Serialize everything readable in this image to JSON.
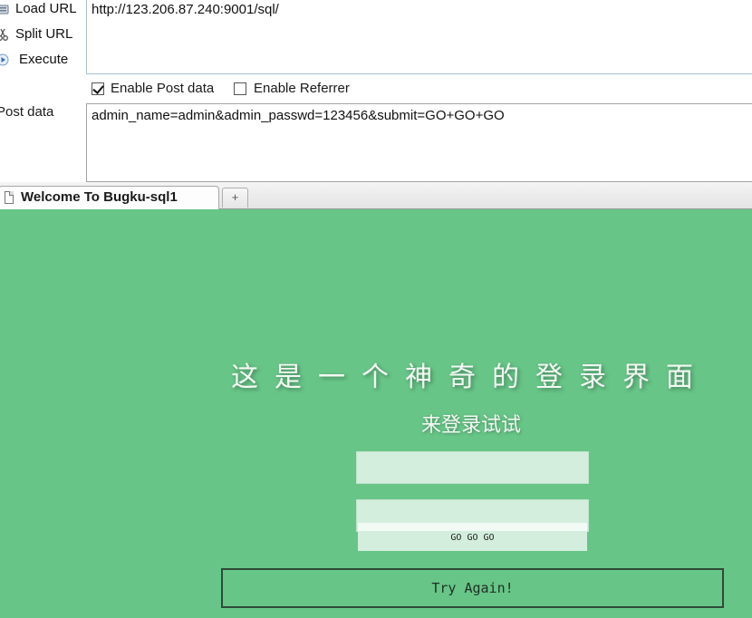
{
  "hackbar": {
    "buttons": {
      "load_url": "Load URL",
      "split_url": "Split URL",
      "execute": "Execute"
    },
    "url_value": "http://123.206.87.240:9001/sql/",
    "options": {
      "enable_post_data": "Enable Post data",
      "enable_post_data_checked": true,
      "enable_referrer": "Enable Referrer",
      "enable_referrer_checked": false
    },
    "post_data_label": "Post data",
    "post_data_value": "admin_name=admin&admin_passwd=123456&submit=GO+GO+GO"
  },
  "tabs": {
    "active_title": "Welcome To Bugku-sql1",
    "new_tab_glyph": "+"
  },
  "page": {
    "background_color": "#67c587",
    "headline": "这是一个神奇的登录界面",
    "subline": "来登录试试",
    "username_value": "",
    "password_value": "",
    "submit_label": "GO GO GO",
    "try_again_label": "Try Again!"
  }
}
